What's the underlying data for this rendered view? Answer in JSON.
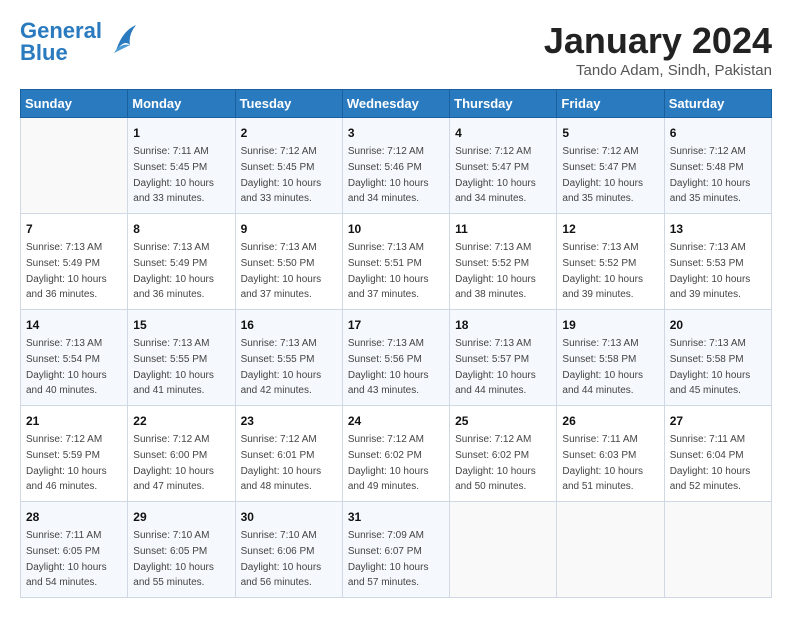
{
  "header": {
    "logo_line1": "General",
    "logo_line2": "Blue",
    "month": "January 2024",
    "location": "Tando Adam, Sindh, Pakistan"
  },
  "weekdays": [
    "Sunday",
    "Monday",
    "Tuesday",
    "Wednesday",
    "Thursday",
    "Friday",
    "Saturday"
  ],
  "weeks": [
    [
      {
        "day": "",
        "info": ""
      },
      {
        "day": "1",
        "info": "Sunrise: 7:11 AM\nSunset: 5:45 PM\nDaylight: 10 hours\nand 33 minutes."
      },
      {
        "day": "2",
        "info": "Sunrise: 7:12 AM\nSunset: 5:45 PM\nDaylight: 10 hours\nand 33 minutes."
      },
      {
        "day": "3",
        "info": "Sunrise: 7:12 AM\nSunset: 5:46 PM\nDaylight: 10 hours\nand 34 minutes."
      },
      {
        "day": "4",
        "info": "Sunrise: 7:12 AM\nSunset: 5:47 PM\nDaylight: 10 hours\nand 34 minutes."
      },
      {
        "day": "5",
        "info": "Sunrise: 7:12 AM\nSunset: 5:47 PM\nDaylight: 10 hours\nand 35 minutes."
      },
      {
        "day": "6",
        "info": "Sunrise: 7:12 AM\nSunset: 5:48 PM\nDaylight: 10 hours\nand 35 minutes."
      }
    ],
    [
      {
        "day": "7",
        "info": "Sunrise: 7:13 AM\nSunset: 5:49 PM\nDaylight: 10 hours\nand 36 minutes."
      },
      {
        "day": "8",
        "info": "Sunrise: 7:13 AM\nSunset: 5:49 PM\nDaylight: 10 hours\nand 36 minutes."
      },
      {
        "day": "9",
        "info": "Sunrise: 7:13 AM\nSunset: 5:50 PM\nDaylight: 10 hours\nand 37 minutes."
      },
      {
        "day": "10",
        "info": "Sunrise: 7:13 AM\nSunset: 5:51 PM\nDaylight: 10 hours\nand 37 minutes."
      },
      {
        "day": "11",
        "info": "Sunrise: 7:13 AM\nSunset: 5:52 PM\nDaylight: 10 hours\nand 38 minutes."
      },
      {
        "day": "12",
        "info": "Sunrise: 7:13 AM\nSunset: 5:52 PM\nDaylight: 10 hours\nand 39 minutes."
      },
      {
        "day": "13",
        "info": "Sunrise: 7:13 AM\nSunset: 5:53 PM\nDaylight: 10 hours\nand 39 minutes."
      }
    ],
    [
      {
        "day": "14",
        "info": "Sunrise: 7:13 AM\nSunset: 5:54 PM\nDaylight: 10 hours\nand 40 minutes."
      },
      {
        "day": "15",
        "info": "Sunrise: 7:13 AM\nSunset: 5:55 PM\nDaylight: 10 hours\nand 41 minutes."
      },
      {
        "day": "16",
        "info": "Sunrise: 7:13 AM\nSunset: 5:55 PM\nDaylight: 10 hours\nand 42 minutes."
      },
      {
        "day": "17",
        "info": "Sunrise: 7:13 AM\nSunset: 5:56 PM\nDaylight: 10 hours\nand 43 minutes."
      },
      {
        "day": "18",
        "info": "Sunrise: 7:13 AM\nSunset: 5:57 PM\nDaylight: 10 hours\nand 44 minutes."
      },
      {
        "day": "19",
        "info": "Sunrise: 7:13 AM\nSunset: 5:58 PM\nDaylight: 10 hours\nand 44 minutes."
      },
      {
        "day": "20",
        "info": "Sunrise: 7:13 AM\nSunset: 5:58 PM\nDaylight: 10 hours\nand 45 minutes."
      }
    ],
    [
      {
        "day": "21",
        "info": "Sunrise: 7:12 AM\nSunset: 5:59 PM\nDaylight: 10 hours\nand 46 minutes."
      },
      {
        "day": "22",
        "info": "Sunrise: 7:12 AM\nSunset: 6:00 PM\nDaylight: 10 hours\nand 47 minutes."
      },
      {
        "day": "23",
        "info": "Sunrise: 7:12 AM\nSunset: 6:01 PM\nDaylight: 10 hours\nand 48 minutes."
      },
      {
        "day": "24",
        "info": "Sunrise: 7:12 AM\nSunset: 6:02 PM\nDaylight: 10 hours\nand 49 minutes."
      },
      {
        "day": "25",
        "info": "Sunrise: 7:12 AM\nSunset: 6:02 PM\nDaylight: 10 hours\nand 50 minutes."
      },
      {
        "day": "26",
        "info": "Sunrise: 7:11 AM\nSunset: 6:03 PM\nDaylight: 10 hours\nand 51 minutes."
      },
      {
        "day": "27",
        "info": "Sunrise: 7:11 AM\nSunset: 6:04 PM\nDaylight: 10 hours\nand 52 minutes."
      }
    ],
    [
      {
        "day": "28",
        "info": "Sunrise: 7:11 AM\nSunset: 6:05 PM\nDaylight: 10 hours\nand 54 minutes."
      },
      {
        "day": "29",
        "info": "Sunrise: 7:10 AM\nSunset: 6:05 PM\nDaylight: 10 hours\nand 55 minutes."
      },
      {
        "day": "30",
        "info": "Sunrise: 7:10 AM\nSunset: 6:06 PM\nDaylight: 10 hours\nand 56 minutes."
      },
      {
        "day": "31",
        "info": "Sunrise: 7:09 AM\nSunset: 6:07 PM\nDaylight: 10 hours\nand 57 minutes."
      },
      {
        "day": "",
        "info": ""
      },
      {
        "day": "",
        "info": ""
      },
      {
        "day": "",
        "info": ""
      }
    ]
  ]
}
